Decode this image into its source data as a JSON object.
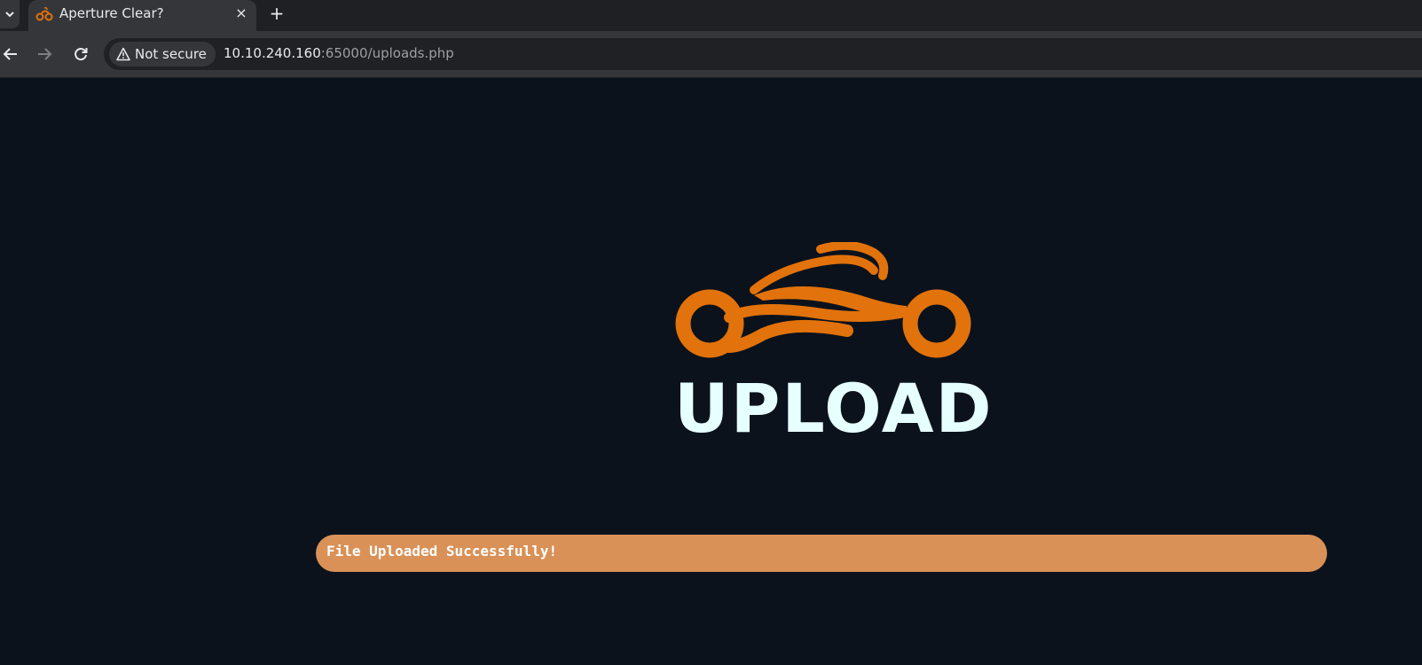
{
  "browser": {
    "tab": {
      "title": "Aperture Clear?",
      "favicon": "motorcycle-icon",
      "close": "×"
    },
    "new_tab": "+",
    "nav": {
      "back": "arrow-left-icon",
      "forward": "arrow-right-icon",
      "reload": "reload-icon"
    },
    "security_label": "Not secure",
    "url": {
      "host": "10.10.240.160",
      "rest": ":65000/uploads.php"
    }
  },
  "page": {
    "logo_icon": "motorcycle-logo",
    "logo_text": "UPLOAD",
    "message": "File Uploaded Successfully!",
    "colors": {
      "background": "#0b121c",
      "accent": "#e2720b",
      "logo_text": "#e6ffff",
      "message_bg": "#d99157"
    }
  }
}
